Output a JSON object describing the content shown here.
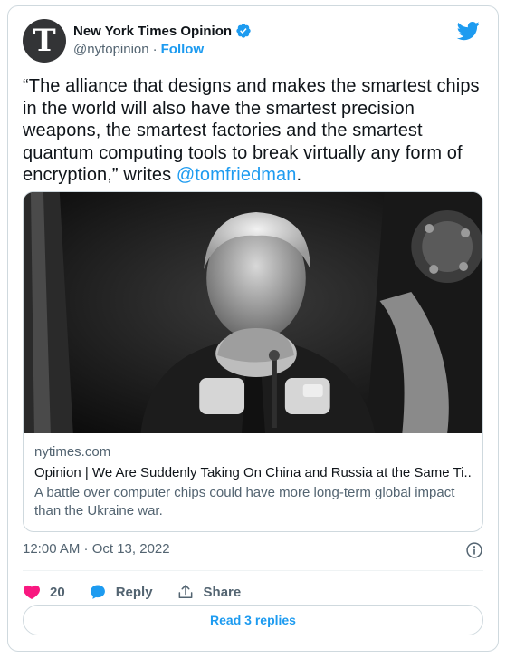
{
  "author": {
    "display_name": "New York Times Opinion",
    "handle": "@nytopinion",
    "separator": "·",
    "follow_label": "Follow",
    "avatar_glyph": "T",
    "verified": true
  },
  "tweet": {
    "text_before": "“The alliance that designs and makes the smartest chips in the world will also have the smartest precision weapons, the smartest factories and the smartest quantum computing tools to break virtually any form of encryption,” writes ",
    "mention": "@tomfriedman",
    "text_after": "."
  },
  "link_card": {
    "domain": "nytimes.com",
    "title": "Opinion | We Are Suddenly Taking On China and Russia at the Same Ti...",
    "description": "A battle over computer chips could have more long-term global impact than the Ukraine war."
  },
  "timestamp": "12:00 AM · Oct 13, 2022",
  "actions": {
    "like_count": "20",
    "reply_label": "Reply",
    "share_label": "Share"
  },
  "read_replies_label": "Read 3 replies",
  "colors": {
    "accent": "#1d9bf0",
    "like": "#f91880",
    "secondary_text": "#536471",
    "border": "#cfd9de"
  },
  "icons": [
    "verified-badge-icon",
    "twitter-bird-icon",
    "info-icon",
    "heart-icon",
    "reply-bubble-icon",
    "share-icon"
  ]
}
